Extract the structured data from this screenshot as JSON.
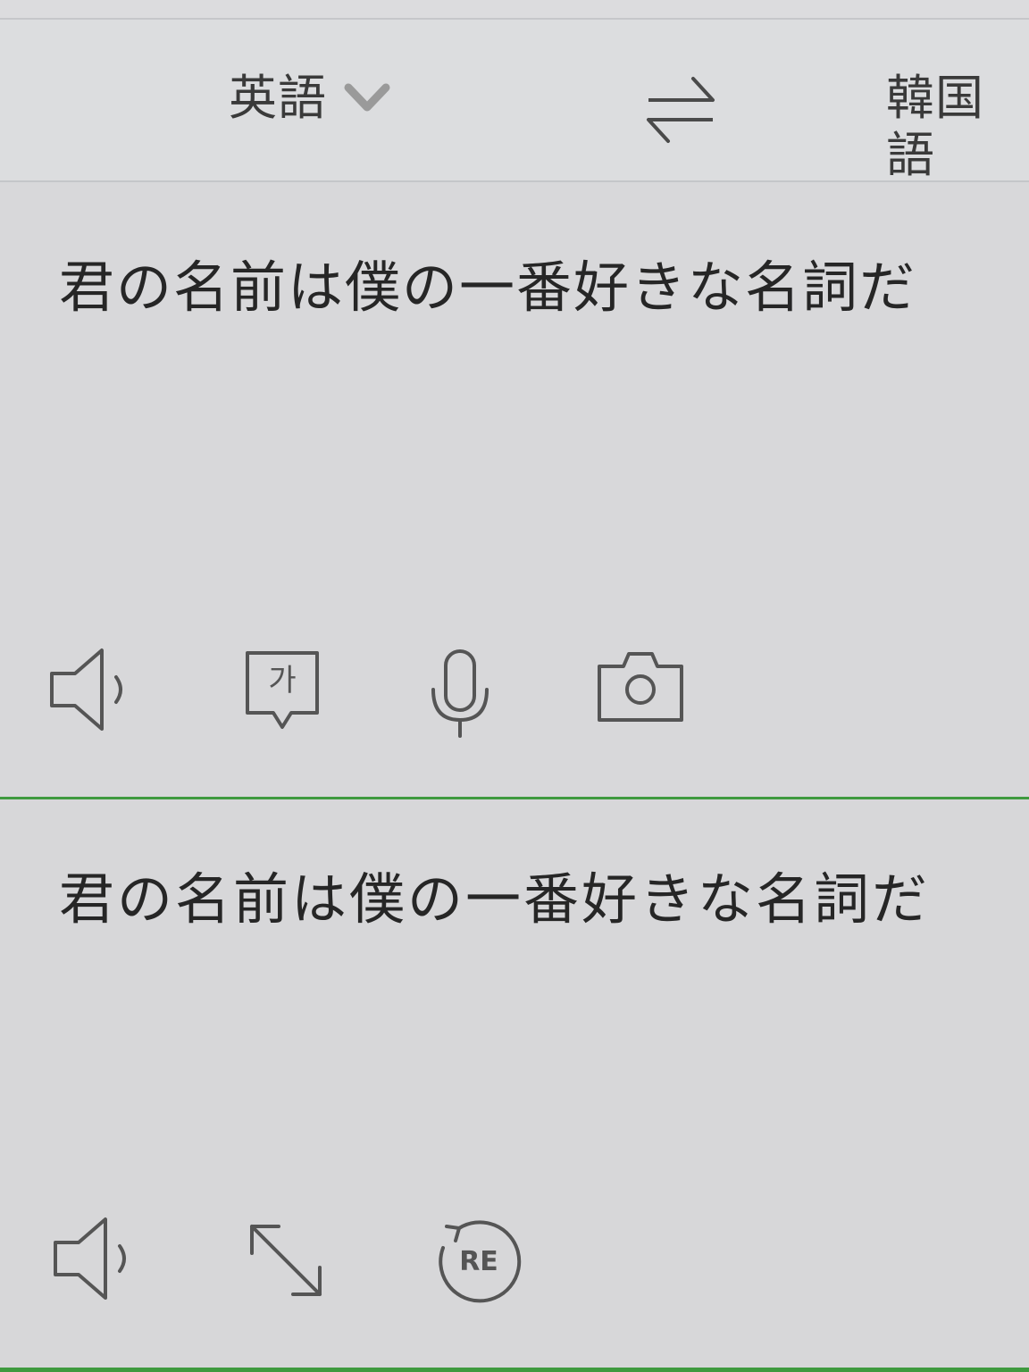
{
  "header": {
    "source_language": "英語",
    "target_language": "韓国語"
  },
  "input": {
    "text": "君の名前は僕の一番好きな名詞だ",
    "tools": [
      {
        "icon": "speaker-icon"
      },
      {
        "icon": "hangul-keyboard-icon",
        "glyph": "가"
      },
      {
        "icon": "microphone-icon"
      },
      {
        "icon": "camera-icon"
      }
    ]
  },
  "output": {
    "text": "君の名前は僕の一番好きな名詞だ",
    "tools": [
      {
        "icon": "speaker-icon"
      },
      {
        "icon": "expand-icon"
      },
      {
        "icon": "retranslate-icon",
        "glyph": "RE"
      }
    ]
  },
  "colors": {
    "accent": "#3f9a3f",
    "background": "#d8d8da",
    "icon": "#555555"
  }
}
